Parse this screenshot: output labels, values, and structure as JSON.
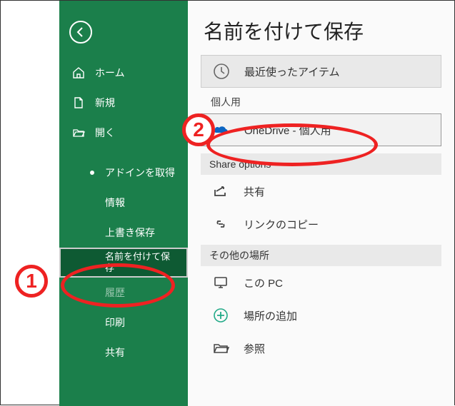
{
  "title": "名前を付けて保存",
  "sidebar": {
    "back": "戻る",
    "home": "ホーム",
    "new": "新規",
    "open": "開く",
    "addins": "アドインを取得",
    "info": "情報",
    "save": "上書き保存",
    "saveas": "名前を付けて保存",
    "history": "履歴",
    "print": "印刷",
    "share": "共有"
  },
  "main": {
    "recent": "最近使ったアイテム",
    "personal_section": "個人用",
    "onedrive": "OneDrive - 個人用",
    "share_options": "Share options",
    "share": "共有",
    "copy_link": "リンクのコピー",
    "other_section": "その他の場所",
    "this_pc": "この PC",
    "add_place": "場所の追加",
    "browse": "参照"
  },
  "annotations": {
    "one": "1",
    "two": "2"
  }
}
